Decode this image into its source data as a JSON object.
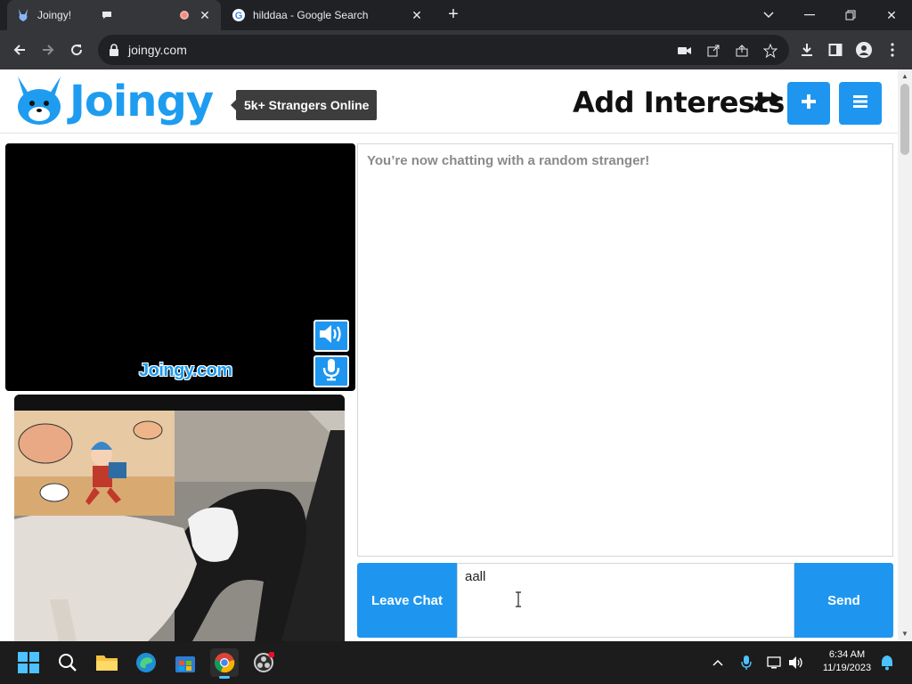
{
  "browser": {
    "tabs": [
      {
        "title": "Joingy!",
        "active": true
      },
      {
        "title": "hilddaa - Google Search",
        "active": false
      }
    ],
    "url": "joingy.com"
  },
  "header": {
    "logo_text": "Joingy",
    "online_badge": "5k+ Strangers Online",
    "add_interests": "Add Interests"
  },
  "video": {
    "watermark": "Joingy.com"
  },
  "chat": {
    "status_message": "You’re now chatting with a random stranger!",
    "input_value": "aall",
    "leave_label": "Leave Chat",
    "send_label": "Send"
  },
  "taskbar": {
    "time": "6:34 AM",
    "date": "11/19/2023"
  },
  "colors": {
    "accent": "#1e96f0",
    "logo": "#1e9cf0"
  }
}
